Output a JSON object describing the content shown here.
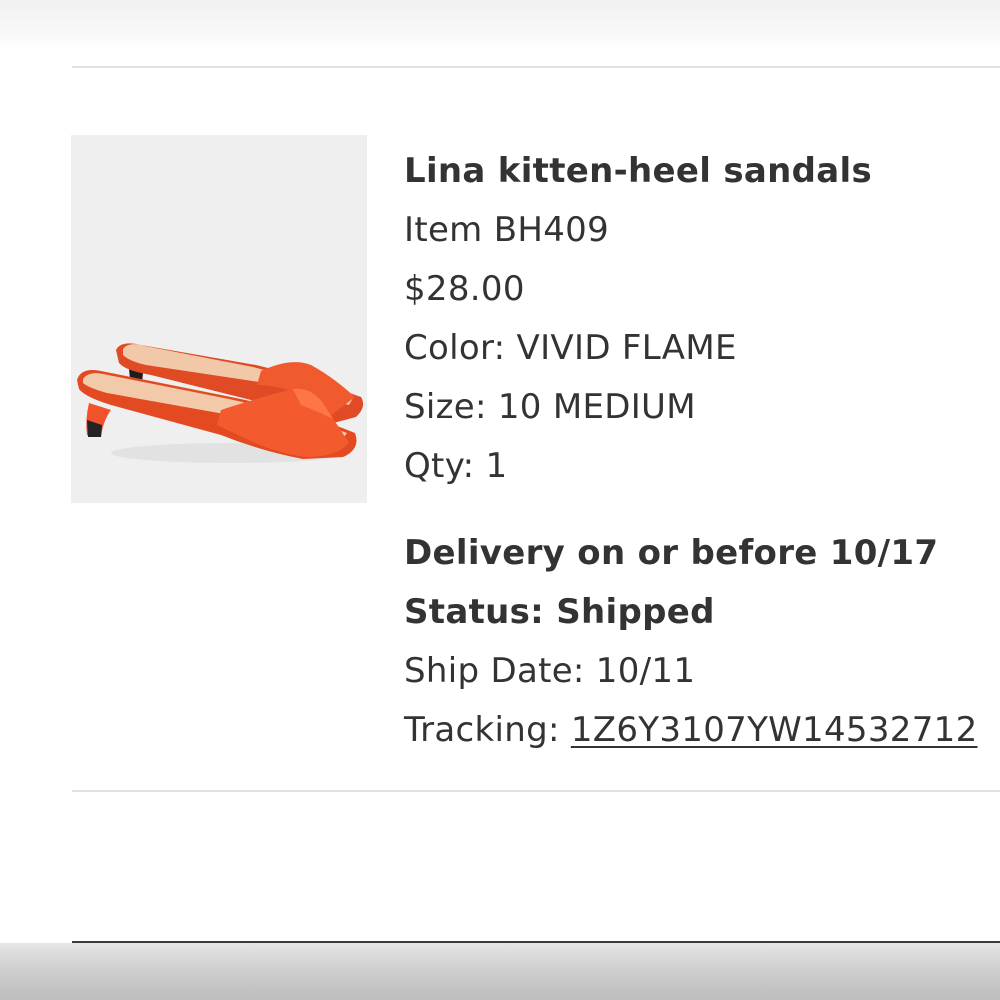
{
  "product": {
    "name": "Lina kitten-heel sandals",
    "item_label": "Item",
    "item_number": "BH409",
    "price": "$28.00",
    "color_label": "Color:",
    "color_value": "VIVID FLAME",
    "size_label": "Size:",
    "size_value": "10 MEDIUM",
    "qty_label": "Qty:",
    "qty_value": "1",
    "image_icon": "sandals-photo"
  },
  "shipment": {
    "delivery_text": "Delivery on or before 10/17",
    "status_label": "Status:",
    "status_value": "Shipped",
    "ship_date_label": "Ship Date:",
    "ship_date_value": "10/11",
    "tracking_label": "Tracking:",
    "tracking_number": "1Z6Y3107YW14532712"
  },
  "colors": {
    "text": "#333333",
    "divider": "#e2e2e2",
    "image_bg": "#efefef",
    "sandal": "#f0522b"
  }
}
